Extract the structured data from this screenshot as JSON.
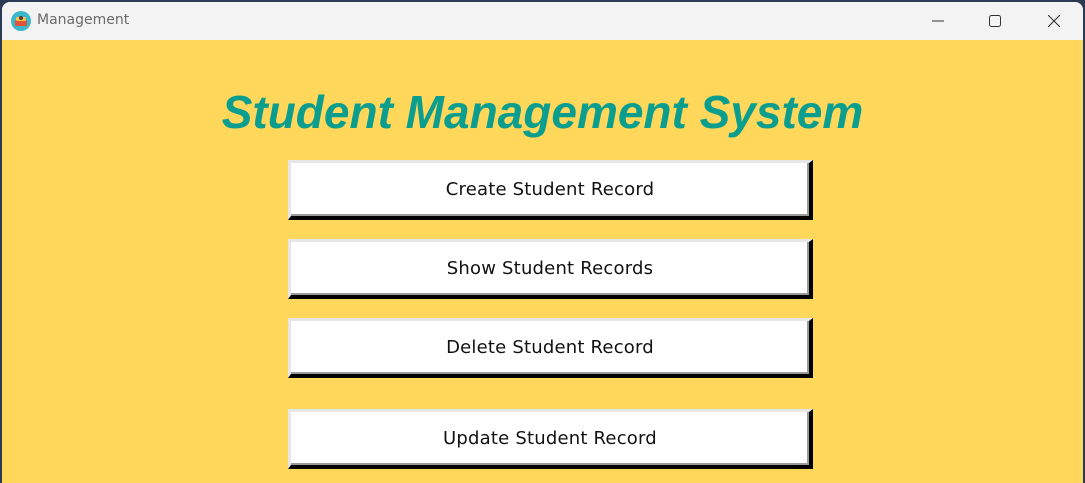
{
  "window": {
    "title": "Management",
    "controls": {
      "minimize_icon": "minimize-icon",
      "maximize_icon": "maximize-icon",
      "close_icon": "close-icon"
    }
  },
  "main": {
    "heading": "Student Management System",
    "buttons": [
      {
        "label": "Create Student Record"
      },
      {
        "label": "Show Student Records"
      },
      {
        "label": "Delete Student Record"
      },
      {
        "label": "Update Student Record"
      }
    ]
  },
  "colors": {
    "background": "#ffd75a",
    "heading": "#0b9e8e",
    "button_face": "#ffffff",
    "titlebar": "#f3f3f3"
  }
}
